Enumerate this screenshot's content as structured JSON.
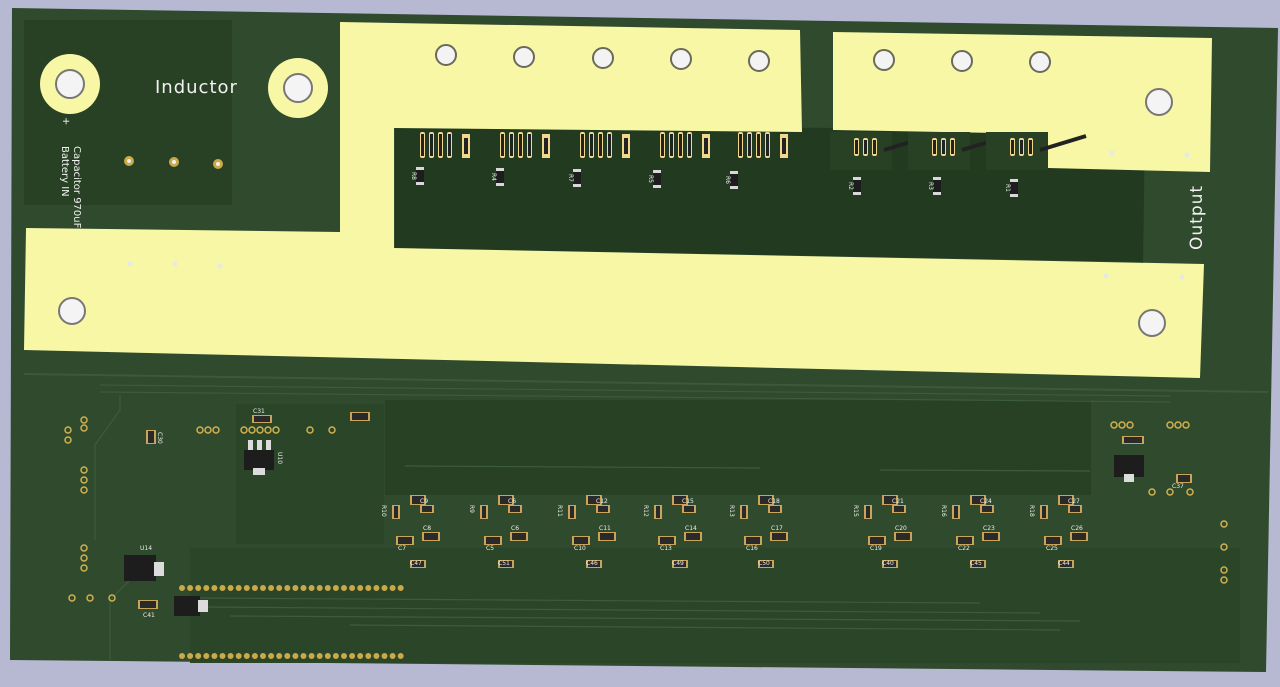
{
  "colors": {
    "background": "#b7b8d2",
    "board": "#2f4a2c",
    "board_dark": "#263f24",
    "copper_pour": "#f7f7a6",
    "silk": "#f2f2f2",
    "pad": "#c8a040",
    "component_body": "#2a2a2a"
  },
  "labels": {
    "inductor": "Inductor",
    "output": "Output",
    "capacitor": "Capacitor 970uF",
    "battery": "Battery IN",
    "plus": "+"
  },
  "top_resistors": [
    "R8",
    "R4",
    "R7",
    "R5",
    "R6",
    "R2",
    "R3",
    "R1"
  ],
  "lower_refs": {
    "u10": "U10",
    "u14": "U14",
    "c31": "C31",
    "c30": "C30",
    "c41": "C41",
    "c37": "C37",
    "bank_a": [
      {
        "r1": "R10",
        "r2": "R9",
        "cTop": "C9",
        "cA": "C7",
        "cB": "C8",
        "cBot": "C47"
      },
      {
        "r1": "R9",
        "r2": "R9",
        "cTop": "C6",
        "cA": "C5",
        "cB": "C6",
        "cBot": "C51"
      },
      {
        "r1": "R11",
        "r2": "R11",
        "cTop": "C12",
        "cA": "C10",
        "cB": "C11",
        "cBot": "C46"
      },
      {
        "r1": "R12",
        "r2": "R12",
        "cTop": "C15",
        "cA": "C13",
        "cB": "C14",
        "cBot": "C49"
      },
      {
        "r1": "R13",
        "r2": "R13",
        "cTop": "C18",
        "cA": "C16",
        "cB": "C17",
        "cBot": "C50"
      }
    ],
    "bank_b": [
      {
        "r1": "R15",
        "r2": "R15",
        "cTop": "C21",
        "cA": "C19",
        "cB": "C20",
        "cBot": "C40"
      },
      {
        "r1": "R16",
        "r2": "R16",
        "cTop": "C24",
        "cA": "C22",
        "cB": "C23",
        "cBot": "C45"
      },
      {
        "r1": "R18",
        "r2": "R18",
        "cTop": "C27",
        "cA": "C25",
        "cB": "C26",
        "cBot": "C44"
      }
    ]
  }
}
